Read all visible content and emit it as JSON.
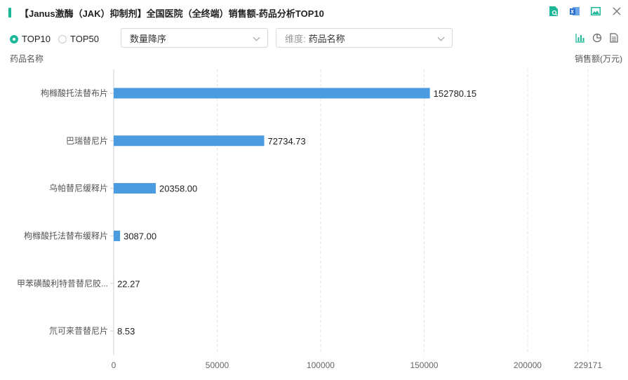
{
  "header": {
    "title": "【Janus激酶（JAK）抑制剂】全国医院（全终端）销售额-药品分析TOP10",
    "icons": [
      "file-search-icon",
      "excel-export-icon",
      "image-export-icon",
      "close-icon"
    ]
  },
  "controls": {
    "radio_top10": "TOP10",
    "radio_top50": "TOP50",
    "sort_select": "数量降序",
    "dimension_label": "维度:",
    "dimension_value": "药品名称",
    "view_icons": [
      "bar-chart-icon",
      "pie-chart-icon",
      "table-view-icon"
    ]
  },
  "chart_data": {
    "type": "bar",
    "orientation": "horizontal",
    "ylabel": "药品名称",
    "xlabel": "销售额(万元)",
    "categories": [
      "枸橼酸托法替布片",
      "巴瑞替尼片",
      "乌帕替尼缓释片",
      "枸橼酸托法替布缓释片",
      "甲苯磺酸利特昔替尼胶...",
      "氘可来昔替尼片"
    ],
    "values": [
      152780.15,
      72734.73,
      20358.0,
      3087.0,
      22.27,
      8.53
    ],
    "value_labels": [
      "152780.15",
      "72734.73",
      "20358.00",
      "3087.00",
      "22.27",
      "8.53"
    ],
    "xlim": [
      0,
      229171
    ],
    "xticks": [
      0,
      50000,
      100000,
      150000,
      200000,
      229171
    ],
    "bar_color": "#4a9be0",
    "grid": true
  }
}
